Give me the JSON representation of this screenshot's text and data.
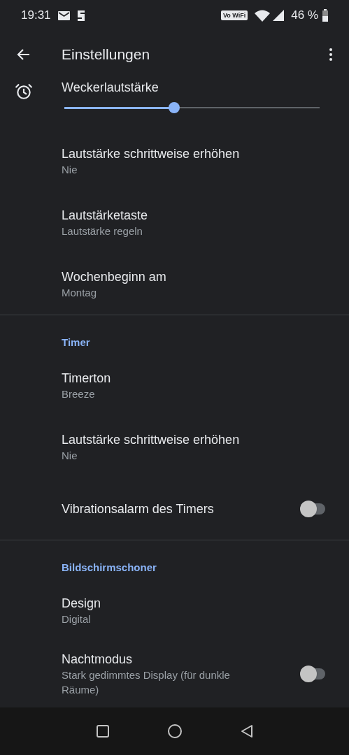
{
  "status_bar": {
    "time": "19:31",
    "wifi_calling_label": "Vo WiFi",
    "battery": "46 %"
  },
  "app_bar": {
    "title": "Einstellungen"
  },
  "sections": [
    {
      "items": [
        {
          "kind": "slider",
          "title": "Weckerlautstärke",
          "level": 0.43
        },
        {
          "kind": "text",
          "title": "Lautstärke schrittweise erhöhen",
          "subtitle": "Nie"
        },
        {
          "kind": "text",
          "title": "Lautstärketaste",
          "subtitle": "Lautstärke regeln"
        },
        {
          "kind": "text",
          "title": "Wochenbeginn am",
          "subtitle": "Montag"
        }
      ]
    },
    {
      "header": "Timer",
      "items": [
        {
          "kind": "text",
          "title": "Timerton",
          "subtitle": "Breeze"
        },
        {
          "kind": "text",
          "title": "Lautstärke schrittweise erhöhen",
          "subtitle": "Nie"
        },
        {
          "kind": "toggle",
          "title": "Vibrationsalarm des Timers",
          "on": false
        }
      ]
    },
    {
      "header": "Bildschirmschoner",
      "items": [
        {
          "kind": "text",
          "title": "Design",
          "subtitle": "Digital"
        },
        {
          "kind": "toggle",
          "title": "Nachtmodus",
          "subtitle": "Stark gedimmtes Display (für dunkle Räume)",
          "on": false
        }
      ]
    }
  ]
}
